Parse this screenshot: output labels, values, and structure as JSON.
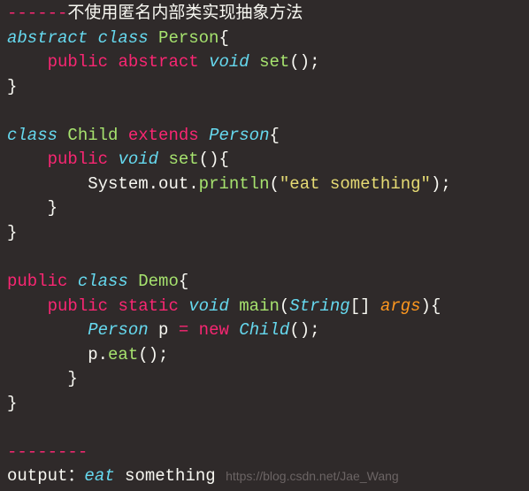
{
  "header": {
    "dashes": "------",
    "comment": "不使用匿名内部类实现抽象方法"
  },
  "line1": {
    "abstract": "abstract",
    "class": "class",
    "name": "Person",
    "brace": "{"
  },
  "line2": {
    "pub": "public",
    "abs": "abstract",
    "void": "void",
    "method": "set",
    "tail": "();"
  },
  "line3": {
    "brace": "}"
  },
  "line5": {
    "class": "class",
    "name": "Child",
    "extends": "extends",
    "parent": "Person",
    "brace": "{"
  },
  "line6": {
    "pub": "public",
    "void": "void",
    "method": "set",
    "tail": "(){"
  },
  "line7": {
    "sys": "System",
    "dot1": ".",
    "out": "out",
    "dot2": ".",
    "println": "println",
    "lp": "(",
    "str": "\"eat something\"",
    "rp": ");"
  },
  "line8": {
    "brace": "}"
  },
  "line9": {
    "brace": "}"
  },
  "line11": {
    "pub": "public",
    "class": "class",
    "name": "Demo",
    "brace": "{"
  },
  "line12": {
    "pub": "public",
    "static": "static",
    "void": "void",
    "main": "main",
    "lp": "(",
    "stringtype": "String",
    "brk": "[] ",
    "args": "args",
    "rp": "){"
  },
  "line13": {
    "ptype": "Person",
    "pvar": " p ",
    "eq": "=",
    "new": "new",
    "child": "Child",
    "tail": "();"
  },
  "line14": {
    "pvar": "p",
    "dot": ".",
    "eat": "eat",
    "tail": "();"
  },
  "line15": {
    "brace": "}"
  },
  "line16": {
    "brace": "}"
  },
  "footer": {
    "dashes": "--------",
    "outlabel": "output：",
    "eat": "eat",
    "something": " something",
    "watermark": "https://blog.csdn.net/Jae_Wang"
  }
}
